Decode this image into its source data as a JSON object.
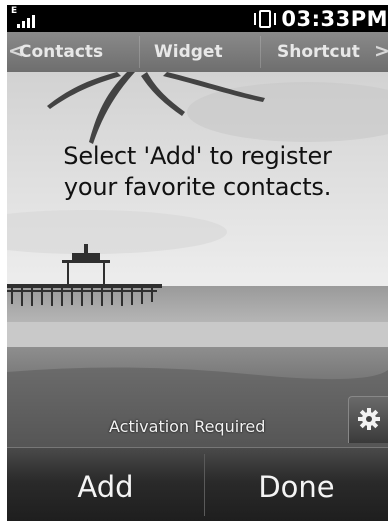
{
  "status_bar": {
    "network_type": "E",
    "clock": "03:33PM"
  },
  "tabs": {
    "left_arrow": "<",
    "right_arrow": ">",
    "items": [
      {
        "label": "Contacts"
      },
      {
        "label": "Widget"
      },
      {
        "label": "Shortcut"
      }
    ]
  },
  "main": {
    "headline_line1": "Select 'Add' to register",
    "headline_line2": "your favorite contacts.",
    "activation_text": "Activation Required"
  },
  "settings": {
    "icon": "gear-icon"
  },
  "softkeys": {
    "add_label": "Add",
    "done_label": "Done"
  }
}
